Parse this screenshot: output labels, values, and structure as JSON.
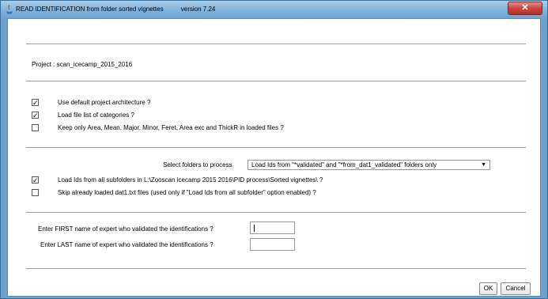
{
  "window": {
    "title": "READ IDENTIFICATION from folder sorted vignettes          version 7.24",
    "close_label": "✕"
  },
  "project": {
    "label": "Project :  scan_icecamp_2015_2016"
  },
  "options": [
    {
      "label": "Use default project architecture ?",
      "checked": true
    },
    {
      "label": "Load file list of categories ?",
      "checked": true
    },
    {
      "label": "Keep only Area, Mean, Major, Minor, Feret, Area exc and ThickR in loaded files ?",
      "checked": false
    }
  ],
  "folders": {
    "label": "Select folders to process",
    "selected": "Load Ids from \"*validated\"  and \"*from_dat1_validated\" folders only",
    "options_arrow": "▼"
  },
  "load_options": [
    {
      "label": "Load Ids from all subfolders in L:\\Zooscan icecamp 2015 2016\\PID process\\Sorted vignettes\\ ?",
      "checked": true
    },
    {
      "label": "Skip already loaded dat1.txt files (used only if \"Load Ids from all subfolder\" option enabled) ?",
      "checked": false
    }
  ],
  "expert": {
    "first_label": "Enter FIRST name of expert who validated the identifications ?",
    "first_value": "",
    "last_label": "Enter LAST name of expert who validated the identifications ?",
    "last_value": ""
  },
  "buttons": {
    "ok": "OK",
    "cancel": "Cancel"
  },
  "colors": {
    "titlebar": "#7fb0da",
    "close": "#c7463d"
  },
  "check_mark": "✓"
}
